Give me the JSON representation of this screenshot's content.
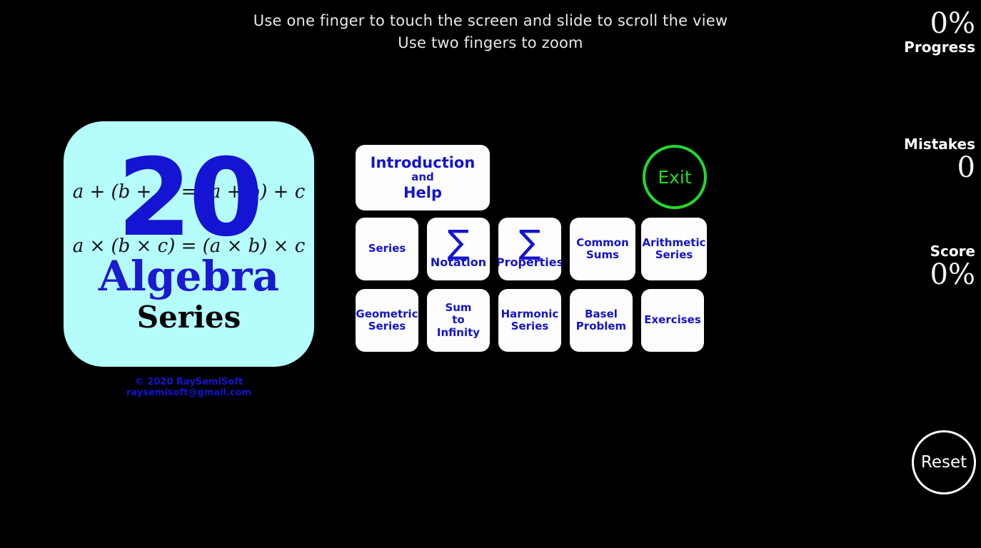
{
  "instructions": {
    "line1": "Use one finger to touch the screen and slide to scroll the view",
    "line2": "Use two fingers to zoom"
  },
  "stats": {
    "progress": {
      "value": "0%",
      "label": "Progress"
    },
    "mistakes": {
      "label": "Mistakes",
      "value": "0"
    },
    "score": {
      "label": "Score",
      "value": "0%"
    }
  },
  "logo": {
    "formula1": "a + (b + c) = (a + b) + c",
    "formula2": "a × (b × c) = (a × b) × c",
    "number": "20",
    "title": "Algebra",
    "subtitle": "Series",
    "background_color": "#b5fcfc",
    "accent_color": "#1414cd"
  },
  "copyright": {
    "line1": "© 2020 RaySemiSoft",
    "line2": "raysemisoft@gmail.com"
  },
  "menu": {
    "intro": {
      "line1": "Introduction",
      "line2": "and",
      "line3": "Help"
    },
    "buttons": [
      {
        "id": "series",
        "lines": [
          "Series"
        ]
      },
      {
        "id": "notation",
        "sigma": "∑",
        "lines": [
          "Notation"
        ]
      },
      {
        "id": "properties",
        "sigma": "∑",
        "lines": [
          "Properties"
        ]
      },
      {
        "id": "common-sums",
        "lines": [
          "Common",
          "Sums"
        ]
      },
      {
        "id": "arithmetic-series",
        "lines": [
          "Arithmetic",
          "Series"
        ]
      },
      {
        "id": "geometric-series",
        "lines": [
          "Geometric",
          "Series"
        ]
      },
      {
        "id": "sum-to-infinity",
        "lines": [
          "Sum",
          "to",
          "Infinity"
        ]
      },
      {
        "id": "harmonic-series",
        "lines": [
          "Harmonic",
          "Series"
        ]
      },
      {
        "id": "basel-problem",
        "lines": [
          "Basel",
          "Problem"
        ]
      },
      {
        "id": "exercises",
        "lines": [
          "Exercises"
        ]
      }
    ]
  },
  "controls": {
    "exit": {
      "label": "Exit",
      "color": "#23d92a"
    },
    "reset": {
      "label": "Reset",
      "color": "#ffffff"
    }
  }
}
